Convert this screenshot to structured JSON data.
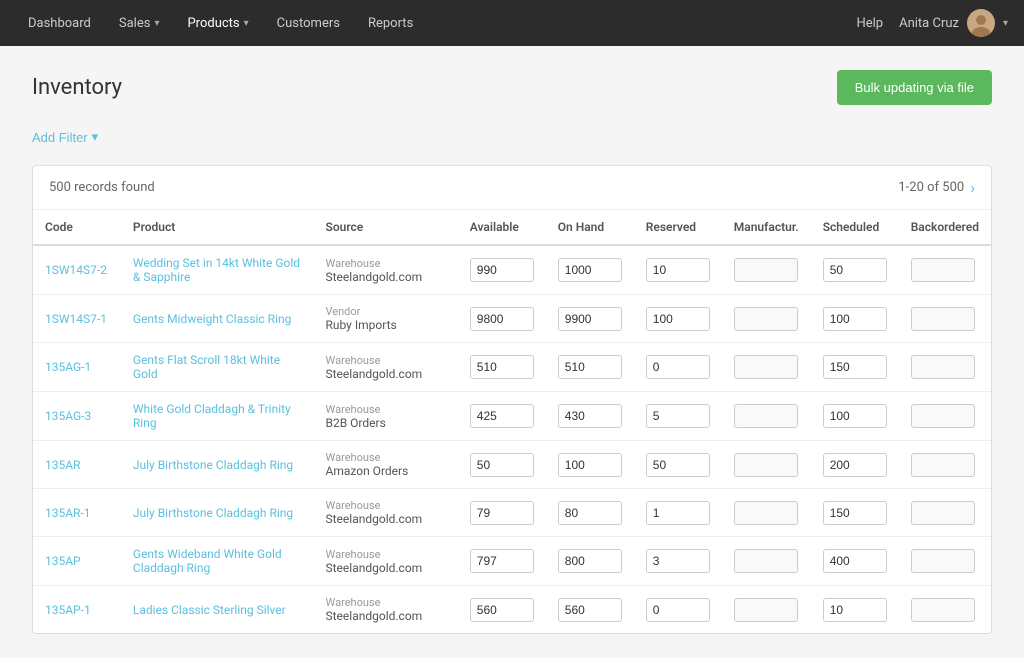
{
  "nav": {
    "items": [
      {
        "label": "Dashboard",
        "id": "dashboard",
        "dropdown": false
      },
      {
        "label": "Sales",
        "id": "sales",
        "dropdown": true
      },
      {
        "label": "Products",
        "id": "products",
        "dropdown": true
      },
      {
        "label": "Customers",
        "id": "customers",
        "dropdown": false
      },
      {
        "label": "Reports",
        "id": "reports",
        "dropdown": false
      }
    ],
    "help_label": "Help",
    "user_name": "Anita Cruz"
  },
  "page": {
    "title": "Inventory",
    "bulk_button": "Bulk updating via file"
  },
  "filter": {
    "add_filter_label": "Add Filter"
  },
  "table": {
    "records_found": "500 records found",
    "pagination": "1-20 of 500",
    "columns": [
      "Code",
      "Product",
      "Source",
      "Available",
      "On Hand",
      "Reserved",
      "Manufactur.",
      "Scheduled",
      "Backordered"
    ],
    "rows": [
      {
        "code": "1SW14S7-2",
        "product": "Wedding Set in 14kt White Gold & Sapphire",
        "source_type": "Warehouse",
        "source_name": "Steelandgold.com",
        "available": "990",
        "on_hand": "1000",
        "reserved": "10",
        "manufactur": "",
        "scheduled": "50",
        "backordered": ""
      },
      {
        "code": "1SW14S7-1",
        "product": "Gents Midweight Classic Ring",
        "source_type": "Vendor",
        "source_name": "Ruby Imports",
        "available": "9800",
        "on_hand": "9900",
        "reserved": "100",
        "manufactur": "",
        "scheduled": "100",
        "backordered": ""
      },
      {
        "code": "135AG-1",
        "product": "Gents Flat Scroll 18kt White Gold",
        "source_type": "Warehouse",
        "source_name": "Steelandgold.com",
        "available": "510",
        "on_hand": "510",
        "reserved": "0",
        "manufactur": "",
        "scheduled": "150",
        "backordered": ""
      },
      {
        "code": "135AG-3",
        "product": "White Gold Claddagh & Trinity Ring",
        "source_type": "Warehouse",
        "source_name": "B2B Orders",
        "available": "425",
        "on_hand": "430",
        "reserved": "5",
        "manufactur": "",
        "scheduled": "100",
        "backordered": ""
      },
      {
        "code": "135AR",
        "product": "July Birthstone Claddagh Ring",
        "source_type": "Warehouse",
        "source_name": "Amazon Orders",
        "available": "50",
        "on_hand": "100",
        "reserved": "50",
        "manufactur": "",
        "scheduled": "200",
        "backordered": ""
      },
      {
        "code": "135AR-1",
        "product": "July Birthstone Claddagh Ring",
        "source_type": "Warehouse",
        "source_name": "Steelandgold.com",
        "available": "79",
        "on_hand": "80",
        "reserved": "1",
        "manufactur": "",
        "scheduled": "150",
        "backordered": ""
      },
      {
        "code": "135AP",
        "product": "Gents Wideband White Gold Claddagh Ring",
        "source_type": "Warehouse",
        "source_name": "Steelandgold.com",
        "available": "797",
        "on_hand": "800",
        "reserved": "3",
        "manufactur": "",
        "scheduled": "400",
        "backordered": ""
      },
      {
        "code": "135AP-1",
        "product": "Ladies Classic Sterling Silver",
        "source_type": "Warehouse",
        "source_name": "Steelandgold.com",
        "available": "560",
        "on_hand": "560",
        "reserved": "0",
        "manufactur": "",
        "scheduled": "10",
        "backordered": ""
      }
    ]
  }
}
